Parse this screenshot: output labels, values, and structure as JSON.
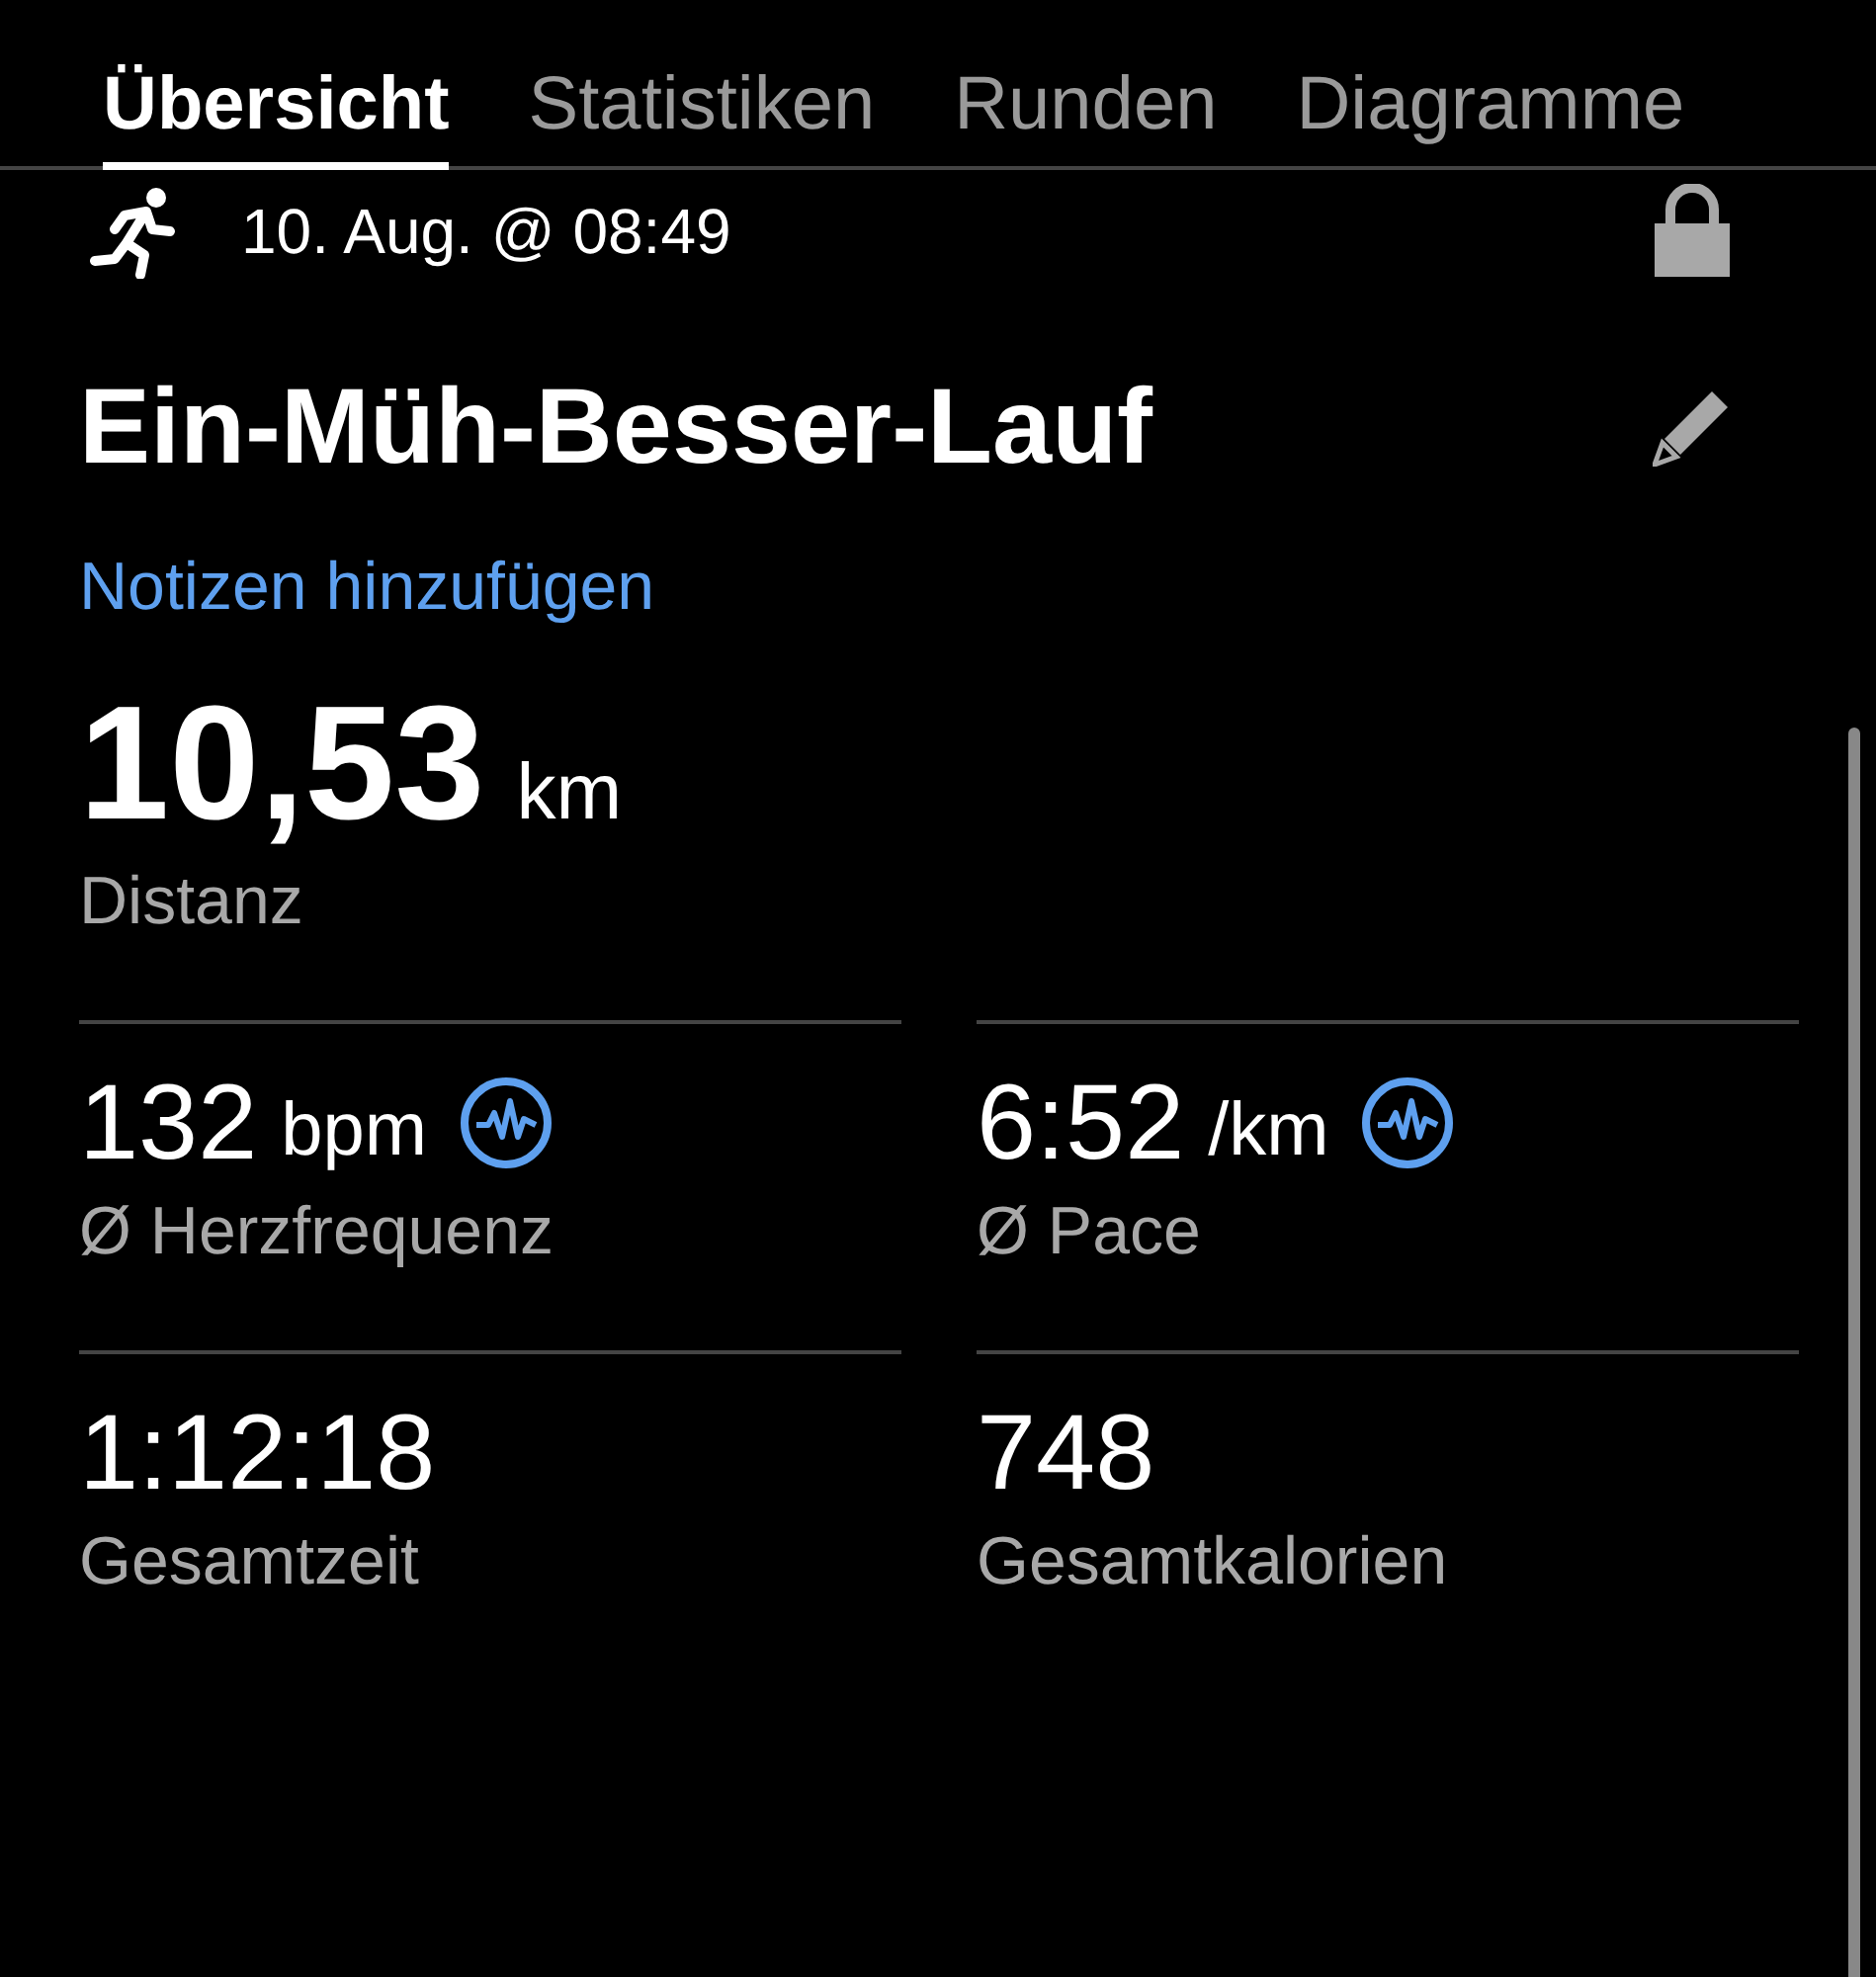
{
  "tabs": [
    {
      "label": "Übersicht",
      "selected": true
    },
    {
      "label": "Statistiken",
      "selected": false
    },
    {
      "label": "Runden",
      "selected": false
    },
    {
      "label": "Diagramme",
      "selected": false
    }
  ],
  "activity": {
    "date": "10. Aug. @ 08:49",
    "locked": true,
    "title": "Ein-Müh-Besser-Lauf",
    "notes_link": "Notizen hinzufügen"
  },
  "distance": {
    "value": "10,53",
    "unit": "km",
    "label": "Distanz"
  },
  "stats": [
    {
      "value": "132",
      "unit": "bpm",
      "label": "Ø Herzfrequenz",
      "graph_badge": true
    },
    {
      "value": "6:52",
      "unit": "/km",
      "label": "Ø Pace",
      "graph_badge": true
    },
    {
      "value": "1:12:18",
      "label": "Gesamtzeit",
      "graph_badge": false
    },
    {
      "value": "748",
      "label": "Gesamtkalorien",
      "graph_badge": false
    }
  ]
}
